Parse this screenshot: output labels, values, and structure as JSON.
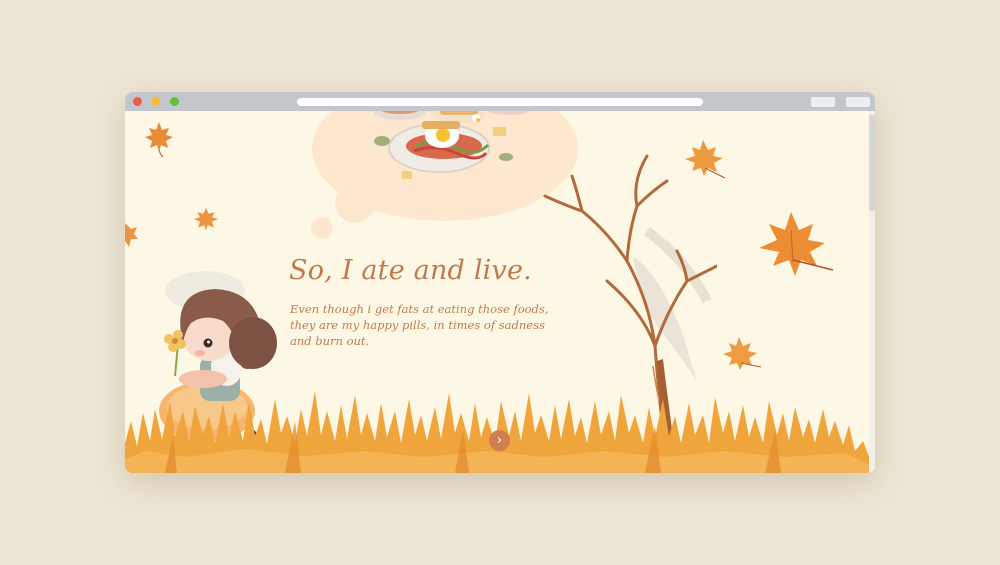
{
  "hero": {
    "title": "So, I ate and live.",
    "description": "Even though i get fats at eating those foods, they are my happy pills, in times of sadness and burn out."
  },
  "navigation": {
    "next_icon": "›"
  },
  "icons": {
    "next": "chevron-right-icon",
    "leaf": "maple-leaf-icon"
  },
  "colors": {
    "page_background": "#ede5d4",
    "viewport_background": "#fdf8e6",
    "accent_text": "#c17a4f",
    "button": "#d0804e",
    "grass": "#f0a43c"
  }
}
